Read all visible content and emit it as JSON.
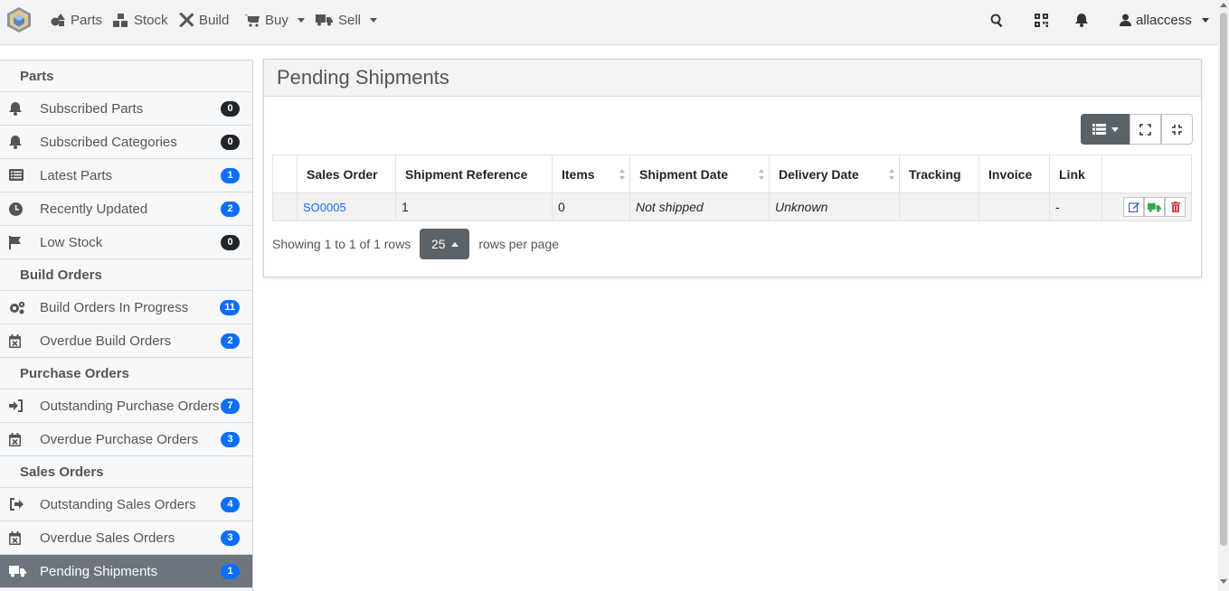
{
  "nav": {
    "items": [
      {
        "label": "Parts",
        "icon": "shapes-icon"
      },
      {
        "label": "Stock",
        "icon": "boxes-icon"
      },
      {
        "label": "Build",
        "icon": "tools-icon"
      },
      {
        "label": "Buy",
        "icon": "cart-icon"
      },
      {
        "label": "Sell",
        "icon": "truck-icon"
      }
    ],
    "user": "allaccess"
  },
  "sidebar": {
    "sections": [
      {
        "heading": "Parts",
        "items": [
          {
            "label": "Subscribed Parts",
            "count": "0",
            "badge": "dark",
            "icon": "bell-icon"
          },
          {
            "label": "Subscribed Categories",
            "count": "0",
            "badge": "dark",
            "icon": "bell-icon"
          },
          {
            "label": "Latest Parts",
            "count": "1",
            "badge": "blue",
            "icon": "list-icon"
          },
          {
            "label": "Recently Updated",
            "count": "2",
            "badge": "blue",
            "icon": "clock-icon"
          },
          {
            "label": "Low Stock",
            "count": "0",
            "badge": "dark",
            "icon": "flag-icon"
          }
        ]
      },
      {
        "heading": "Build Orders",
        "items": [
          {
            "label": "Build Orders In Progress",
            "count": "11",
            "badge": "blue",
            "icon": "cogs-icon"
          },
          {
            "label": "Overdue Build Orders",
            "count": "2",
            "badge": "blue",
            "icon": "calendar-x-icon"
          }
        ]
      },
      {
        "heading": "Purchase Orders",
        "items": [
          {
            "label": "Outstanding Purchase Orders",
            "count": "7",
            "badge": "blue",
            "icon": "sign-in-icon"
          },
          {
            "label": "Overdue Purchase Orders",
            "count": "3",
            "badge": "blue",
            "icon": "calendar-x-icon"
          }
        ]
      },
      {
        "heading": "Sales Orders",
        "items": [
          {
            "label": "Outstanding Sales Orders",
            "count": "4",
            "badge": "blue",
            "icon": "sign-out-icon"
          },
          {
            "label": "Overdue Sales Orders",
            "count": "3",
            "badge": "blue",
            "icon": "calendar-x-icon"
          },
          {
            "label": "Pending Shipments",
            "count": "1",
            "badge": "blue",
            "icon": "truck-icon",
            "active": true
          }
        ]
      }
    ]
  },
  "panel": {
    "title": "Pending Shipments",
    "columns": [
      "Sales Order",
      "Shipment Reference",
      "Items",
      "Shipment Date",
      "Delivery Date",
      "Tracking",
      "Invoice",
      "Link"
    ],
    "rows": [
      {
        "sales_order": "SO0005",
        "reference": "1",
        "items": "0",
        "shipment_date": "Not shipped",
        "delivery_date": "Unknown",
        "tracking": "",
        "invoice": "",
        "link": "-"
      }
    ],
    "footer": {
      "showing": "Showing 1 to 1 of 1 rows",
      "page_size": "25",
      "suffix": "rows per page"
    }
  },
  "colors": {
    "accent": "#0d6efd",
    "badge_dark": "#212529",
    "active_bg": "#6c757d"
  }
}
